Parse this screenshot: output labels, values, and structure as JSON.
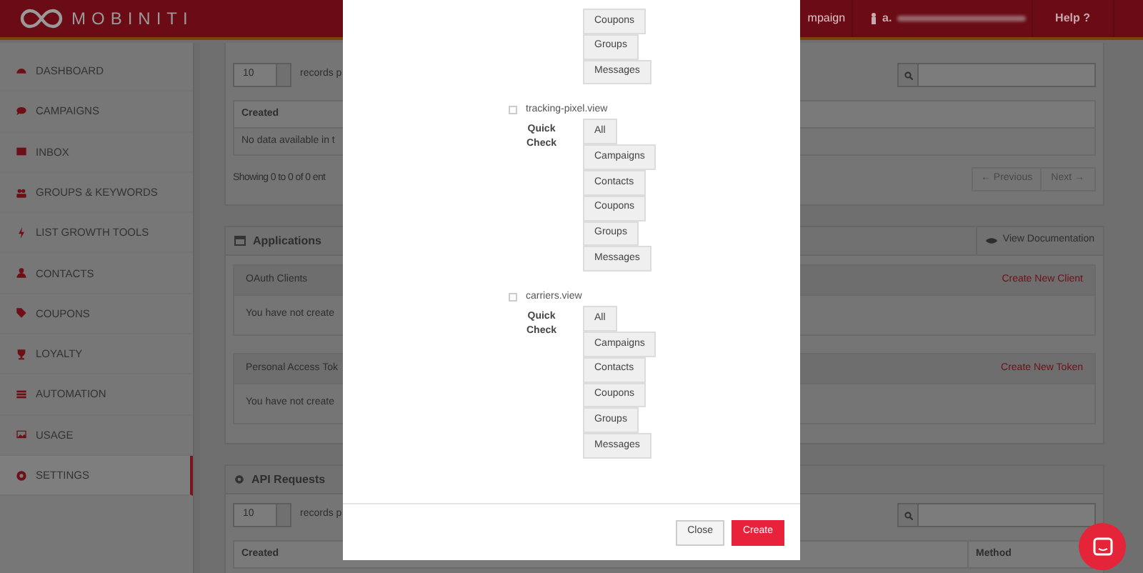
{
  "header": {
    "logo": "MOBINITI",
    "nav_partial": "mpaign",
    "user": "a.",
    "help": "Help ?"
  },
  "sidebar": {
    "items": [
      {
        "label": "DASHBOARD",
        "kind": "dashboard",
        "selected": false
      },
      {
        "label": "CAMPAIGNS",
        "kind": "chat",
        "selected": false
      },
      {
        "label": "INBOX",
        "kind": "mail",
        "selected": false
      },
      {
        "label": "GROUPS & KEYWORDS",
        "kind": "group",
        "selected": false
      },
      {
        "label": "LIST GROWTH TOOLS",
        "kind": "bolt",
        "selected": false
      },
      {
        "label": "CONTACTS",
        "kind": "user",
        "selected": false
      },
      {
        "label": "COUPONS",
        "kind": "tag",
        "selected": false
      },
      {
        "label": "LOYALTY",
        "kind": "trophy",
        "selected": false
      },
      {
        "label": "AUTOMATION",
        "kind": "list",
        "selected": false
      },
      {
        "label": "USAGE",
        "kind": "image",
        "selected": false
      },
      {
        "label": "SETTINGS",
        "kind": "gear",
        "selected": true
      }
    ]
  },
  "integration_errors": {
    "page_size": "10",
    "records_label": "records p",
    "column": "Created",
    "empty": "No data available in t",
    "info": "Showing 0 to 0 of 0 ent",
    "previous": "← Previous",
    "next": "Next →"
  },
  "applications": {
    "title": "Applications",
    "docs_button": "View Documentation",
    "sections": [
      {
        "title": "OAuth Clients",
        "action": "Create New Client",
        "empty": "You have not create"
      },
      {
        "title": "Personal Access Tok",
        "action": "Create New Token",
        "empty": "You have not create"
      }
    ]
  },
  "api_requests": {
    "title": "API Requests",
    "page_size": "10",
    "records_label": "records p",
    "columns": [
      "Created",
      "Method"
    ]
  },
  "modal": {
    "scopes": [
      {
        "buttons": [
          "Coupons",
          "Groups",
          "Messages"
        ]
      },
      {
        "name": "tracking-pixel.view",
        "checked": false,
        "quick_check": "Quick Check",
        "buttons": [
          "All",
          "Campaigns",
          "Contacts",
          "Coupons",
          "Groups",
          "Messages"
        ]
      },
      {
        "name": "carriers.view",
        "checked": false,
        "quick_check": "Quick Check",
        "buttons": [
          "All",
          "Campaigns",
          "Contacts",
          "Coupons",
          "Groups",
          "Messages"
        ]
      }
    ],
    "close": "Close",
    "create": "Create"
  }
}
